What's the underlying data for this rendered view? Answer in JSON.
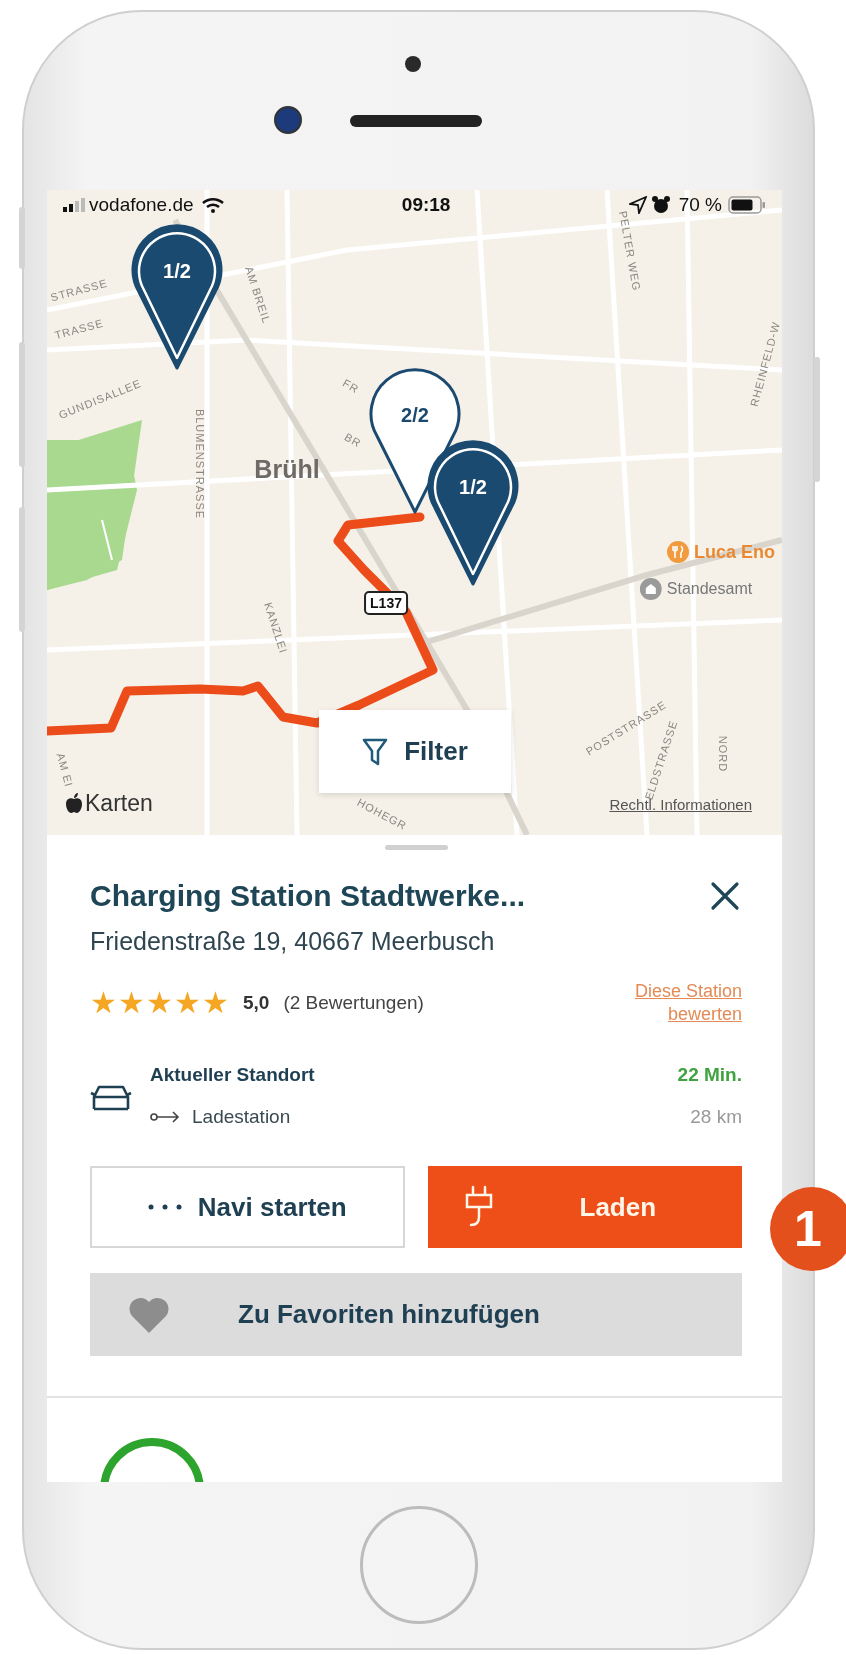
{
  "status_bar": {
    "carrier": "vodafone.de",
    "time": "09:18",
    "battery": "70 %"
  },
  "map": {
    "labels": [
      {
        "text": "STRASSE",
        "kind": "street"
      },
      {
        "text": "AM BREIL",
        "kind": "street"
      },
      {
        "text": "PELTER WEG",
        "kind": "street"
      },
      {
        "text": "TRASSE",
        "kind": "street"
      },
      {
        "text": "RHEINFELD-W",
        "kind": "street"
      },
      {
        "text": "FR",
        "kind": "street"
      },
      {
        "text": "GUNDISALLEE",
        "kind": "street"
      },
      {
        "text": "BR",
        "kind": "street"
      },
      {
        "text": "Brühl",
        "kind": "town"
      },
      {
        "text": "BLUMENSTRASSE",
        "kind": "street"
      },
      {
        "text": "Luca Eno",
        "kind": "food"
      },
      {
        "text": "Standesamt",
        "kind": "civic"
      },
      {
        "text": "L137",
        "kind": "shield"
      },
      {
        "text": "KANZLEI",
        "kind": "street"
      },
      {
        "text": "POSTSTRASSE",
        "kind": "street"
      },
      {
        "text": "ELDSTRASSE",
        "kind": "street"
      },
      {
        "text": "NORD",
        "kind": "street"
      },
      {
        "text": "AM EI",
        "kind": "street"
      },
      {
        "text": "HOHEGR",
        "kind": "street"
      }
    ],
    "pins": [
      {
        "label": "1/2",
        "selected": false
      },
      {
        "label": "2/2",
        "selected": true
      },
      {
        "label": "1/2",
        "selected": false
      }
    ],
    "filter_button": "Filter",
    "attribution": "Karten",
    "legal_link": "Rechtl. Informationen"
  },
  "station": {
    "title": "Charging Station Stadtwerke...",
    "address": "Friedenstraße 19, 40667 Meerbusch",
    "stars": 5,
    "rating": "5,0",
    "reviews": "(2 Bewertungen)",
    "rate_link": "Diese Station bewerten",
    "route": {
      "from": "Aktueller Standort",
      "to": "Ladestation",
      "duration": "22 Min.",
      "distance": "28 km"
    },
    "actions": [
      {
        "label": "Navi starten",
        "kind": "navigate"
      },
      {
        "label": "Laden",
        "kind": "charge"
      },
      {
        "label": "Zu Favoriten hinzufügen",
        "kind": "favorite"
      }
    ]
  },
  "callout": "1"
}
